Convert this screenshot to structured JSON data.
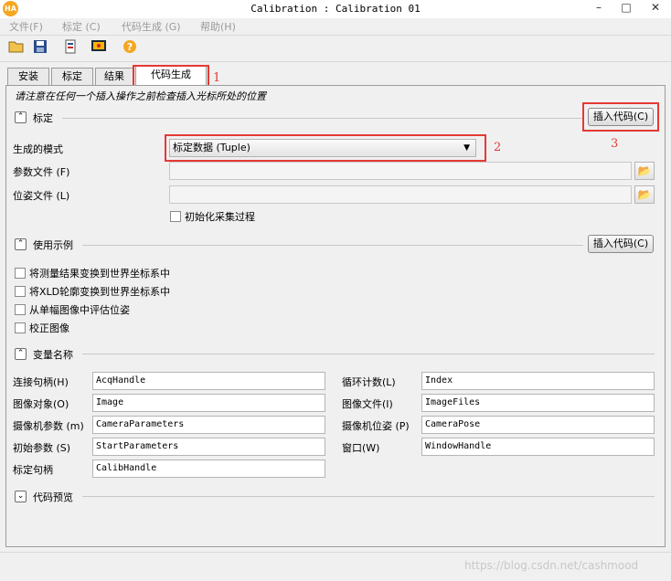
{
  "window": {
    "title": "Calibration : Calibration 01",
    "app_icon": "HA"
  },
  "menu": [
    {
      "label": "文件(F)"
    },
    {
      "label": "标定 (C)"
    },
    {
      "label": "代码生成 (G)"
    },
    {
      "label": "帮助(H)"
    }
  ],
  "toolbar": {
    "icons": [
      "open-folder-icon",
      "save-icon",
      "export-icon",
      "settings-icon",
      "help-icon"
    ]
  },
  "tabs": [
    {
      "label": "安装"
    },
    {
      "label": "标定"
    },
    {
      "label": "结果"
    },
    {
      "label": "代码生成",
      "active": true
    }
  ],
  "info_text": "请注意在任何一个插入操作之前检查插入光标所处的位置",
  "calibration_section": {
    "title": "标定",
    "insert_code_label": "插入代码(C)",
    "mode_label": "生成的模式",
    "mode_value": "标定数据 (Tuple)",
    "param_file_label": "参数文件 (F)",
    "param_file_value": "",
    "pose_file_label": "位姿文件 (L)",
    "pose_file_value": "",
    "init_checkbox_label": "初始化采集过程"
  },
  "examples_section": {
    "title": "使用示例",
    "insert_code_label": "插入代码(C)",
    "options": [
      {
        "label": "将测量结果变换到世界坐标系中"
      },
      {
        "label": "将XLD轮廓变换到世界坐标系中"
      },
      {
        "label": "从单幅图像中评估位姿"
      },
      {
        "label": "校正图像"
      }
    ]
  },
  "variables_section": {
    "title": "变量名称",
    "left": [
      {
        "label": "连接句柄(H)",
        "value": "AcqHandle"
      },
      {
        "label": "图像对象(O)",
        "value": "Image"
      },
      {
        "label": "摄像机参数 (m)",
        "value": "CameraParameters"
      },
      {
        "label": "初始参数 (S)",
        "value": "StartParameters"
      },
      {
        "label": "标定句柄",
        "value": "CalibHandle"
      }
    ],
    "right": [
      {
        "label": "循环计数(L)",
        "value": "Index"
      },
      {
        "label": "图像文件(I)",
        "value": "ImageFiles"
      },
      {
        "label": "摄像机位姿 (P)",
        "value": "CameraPose"
      },
      {
        "label": "窗口(W)",
        "value": "WindowHandle"
      }
    ]
  },
  "preview_section": {
    "title": "代码预览"
  },
  "annotations": {
    "mark1": "1",
    "mark2": "2",
    "mark3": "3"
  },
  "watermark": "https://blog.csdn.net/cashmood",
  "colors": {
    "annotation": "#e53935",
    "accent": "#f5a623"
  }
}
